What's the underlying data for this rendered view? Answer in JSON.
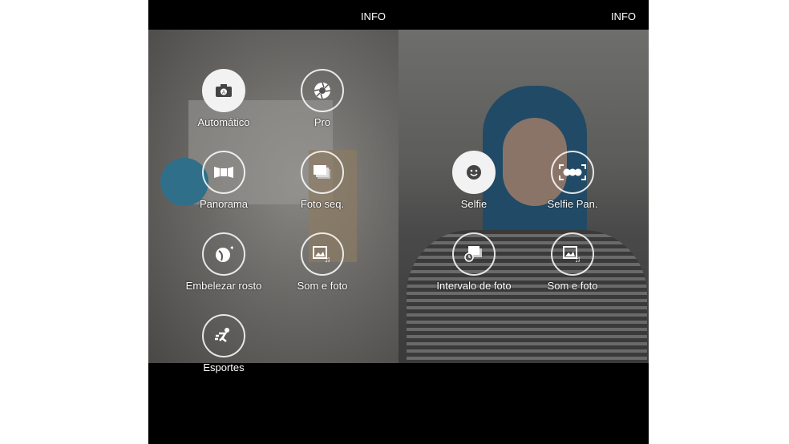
{
  "left": {
    "info": "INFO",
    "modes": [
      {
        "label": "Automático",
        "icon": "camera-auto-icon",
        "selected": true
      },
      {
        "label": "Pro",
        "icon": "aperture-icon",
        "selected": false
      },
      {
        "label": "Panorama",
        "icon": "panorama-icon",
        "selected": false
      },
      {
        "label": "Foto seq.",
        "icon": "burst-icon",
        "selected": false
      },
      {
        "label": "Embelezar rosto",
        "icon": "beauty-face-icon",
        "selected": false
      },
      {
        "label": "Som e foto",
        "icon": "sound-photo-icon",
        "selected": false
      },
      {
        "label": "Esportes",
        "icon": "sports-icon",
        "selected": false
      }
    ]
  },
  "right": {
    "info": "INFO",
    "modes": [
      {
        "label": "Selfie",
        "icon": "selfie-icon",
        "selected": true
      },
      {
        "label": "Selfie Pan.",
        "icon": "wide-selfie-icon",
        "selected": false
      },
      {
        "label": "Intervalo de foto",
        "icon": "interval-icon",
        "selected": false
      },
      {
        "label": "Som e foto",
        "icon": "sound-photo-icon",
        "selected": false
      }
    ]
  }
}
